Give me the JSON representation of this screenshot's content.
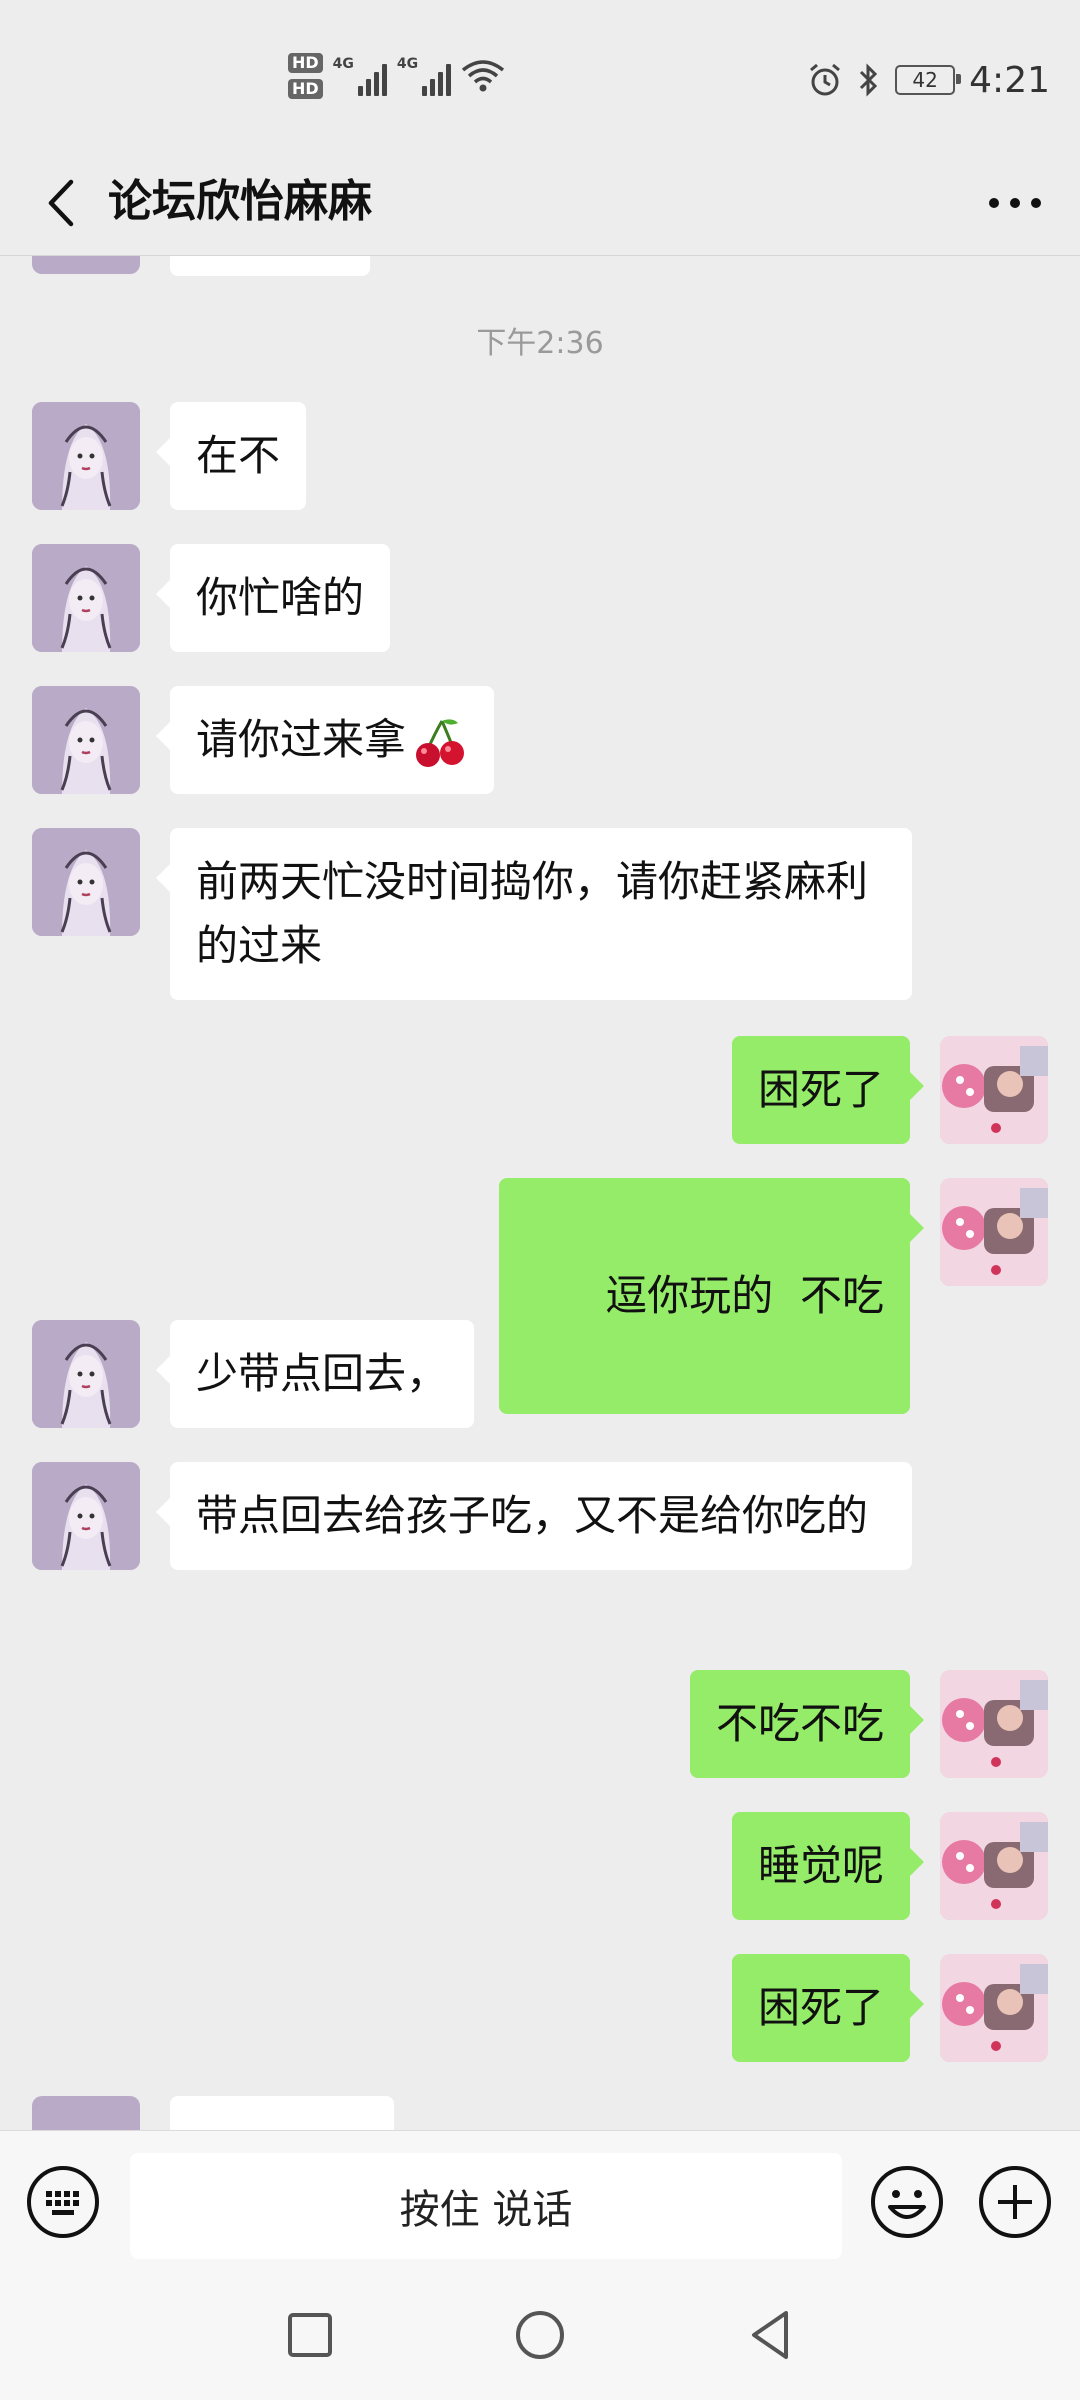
{
  "status_bar": {
    "time": "4:21",
    "battery": "42",
    "hd1": "HD",
    "hd2": "HD",
    "net1": "4G",
    "net2": "4G",
    "icons": [
      "hd-icon",
      "signal-icon",
      "wifi-icon",
      "alarm-icon",
      "bluetooth-icon",
      "battery-icon"
    ]
  },
  "header": {
    "title": "论坛欣怡麻麻",
    "back_icon": "chevron-left-icon",
    "more_icon": "more-dots-icon"
  },
  "chat": {
    "timestamp": "下午2:36",
    "messages": [
      {
        "side": "left",
        "text": "在不"
      },
      {
        "side": "left",
        "text": "你忙啥的"
      },
      {
        "side": "left",
        "text": "请你过来拿",
        "emoji": "cherry"
      },
      {
        "side": "left",
        "text": "前两天忙没时间捣你，请你赶紧麻利的过来"
      },
      {
        "side": "right",
        "text": "困死了"
      },
      {
        "side": "right",
        "text": "逗你玩的  不吃"
      },
      {
        "side": "left",
        "text": "少带点回去，"
      },
      {
        "side": "left",
        "text": "带点回去给孩子吃，又不是给你吃的"
      },
      {
        "side": "right",
        "text": "不吃不吃"
      },
      {
        "side": "right",
        "text": "睡觉呢"
      },
      {
        "side": "right",
        "text": "困死了"
      }
    ]
  },
  "input_bar": {
    "voice_label": "按住 说话",
    "keyboard_icon": "keyboard-icon",
    "emoji_icon": "smiley-icon",
    "plus_icon": "plus-circle-icon"
  },
  "colors": {
    "background": "#ededed",
    "bubble_self": "#95ec69",
    "bubble_other": "#ffffff"
  }
}
